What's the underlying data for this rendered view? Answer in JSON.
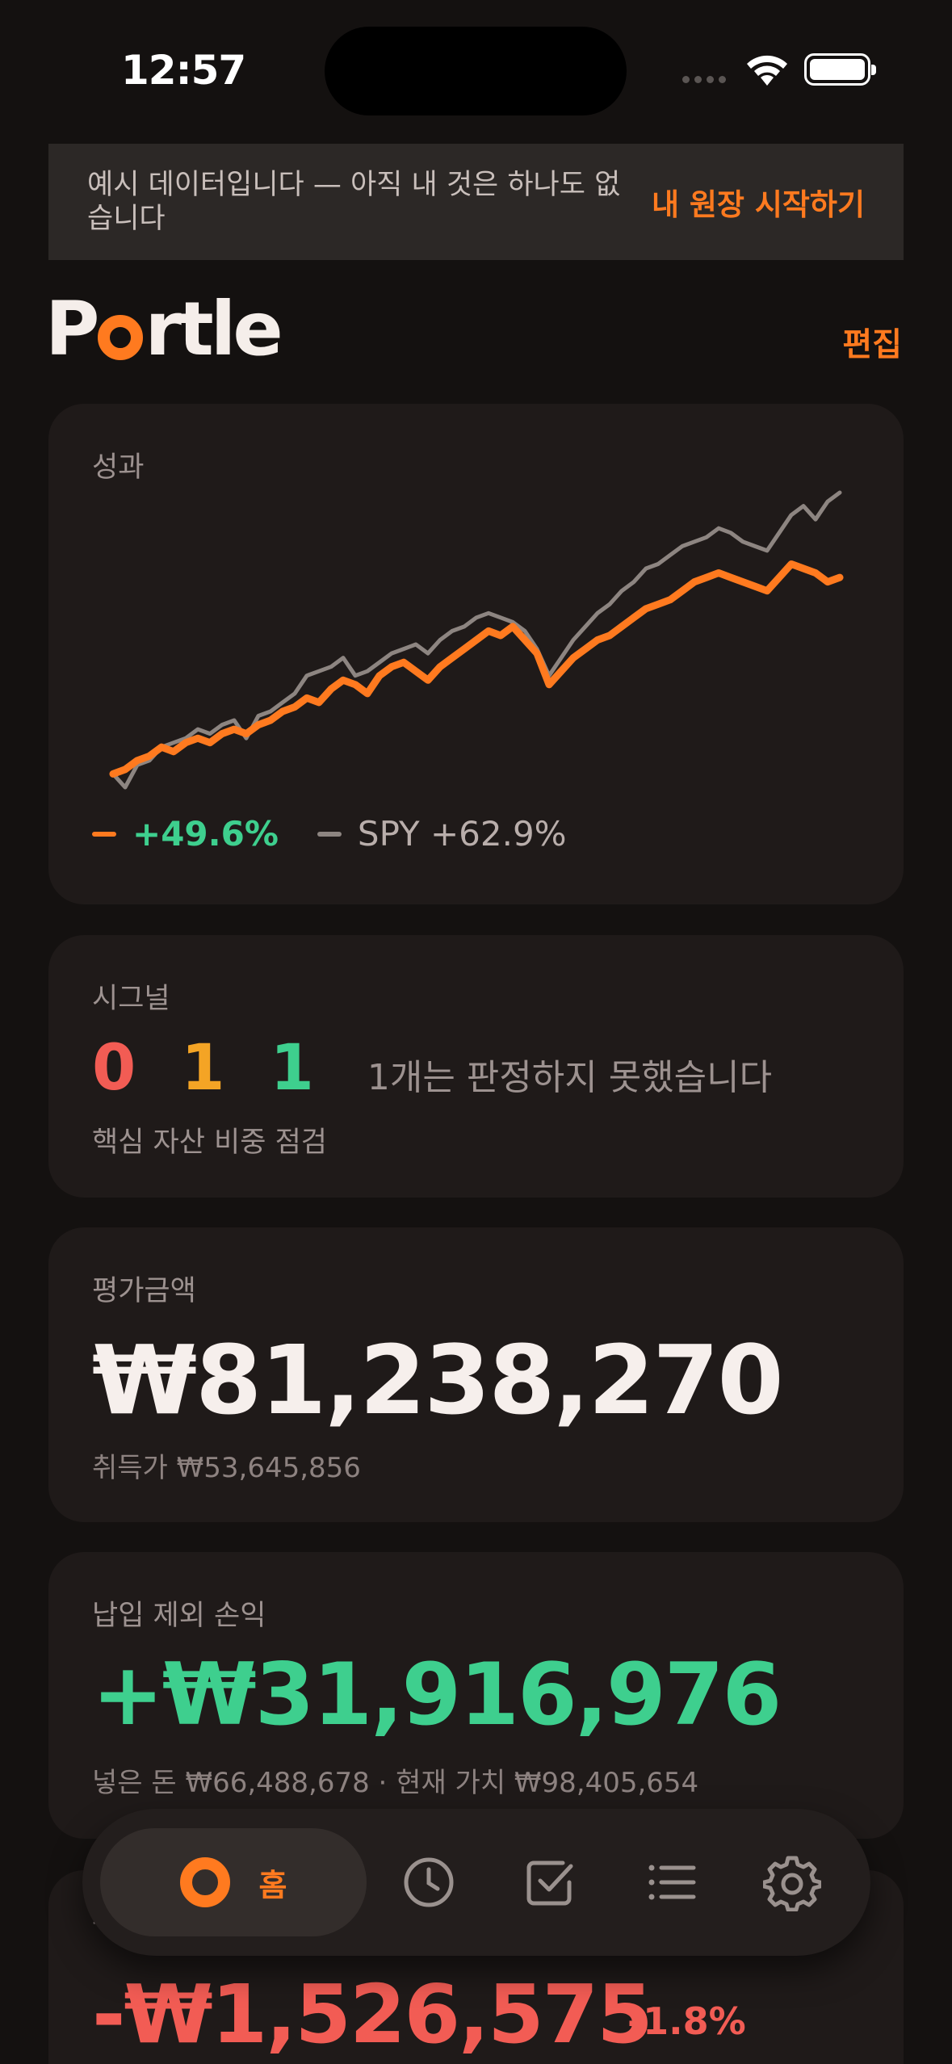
{
  "status": {
    "time": "12:57"
  },
  "banner": {
    "text": "예시 데이터입니다 — 아직 내 것은 하나도 없습니다",
    "cta": "내 원장 시작하기"
  },
  "header": {
    "logo_before": "P",
    "logo_after": "rtle",
    "edit": "편집"
  },
  "performance": {
    "label": "성과",
    "portfolio_return": "+49.6%",
    "benchmark_label": "SPY +62.9%",
    "colors": {
      "portfolio": "#ff7a1f",
      "benchmark": "#8d8581"
    }
  },
  "chart_data": {
    "type": "line",
    "title": "",
    "xlabel": "",
    "ylabel": "",
    "x": [
      0,
      1,
      2,
      3,
      4,
      5,
      6,
      7,
      8,
      9,
      10,
      11,
      12,
      13,
      14,
      15,
      16,
      17,
      18,
      19,
      20,
      21,
      22,
      23,
      24,
      25,
      26,
      27,
      28,
      29,
      30,
      31,
      32,
      33,
      34,
      35,
      36,
      37,
      38,
      39,
      40,
      41,
      42,
      43,
      44,
      45,
      46,
      47,
      48,
      49,
      50,
      51,
      52,
      53,
      54,
      55,
      56,
      57,
      58,
      59,
      60
    ],
    "series": [
      {
        "name": "+49.6%",
        "values": [
          0,
          1,
          3,
          4,
          6,
          5,
          7,
          8,
          7,
          9,
          10,
          9,
          11,
          12,
          14,
          15,
          17,
          16,
          19,
          21,
          20,
          18,
          22,
          24,
          25,
          23,
          21,
          24,
          26,
          28,
          30,
          32,
          31,
          33,
          30,
          27,
          20,
          23,
          26,
          28,
          30,
          31,
          33,
          35,
          37,
          38,
          39,
          41,
          43,
          44,
          45,
          44,
          43,
          42,
          41,
          44,
          47,
          46,
          45,
          43,
          44
        ]
      },
      {
        "name": "SPY +62.9%",
        "values": [
          0,
          -3,
          2,
          3,
          6,
          7,
          8,
          10,
          9,
          11,
          12,
          8,
          13,
          14,
          16,
          18,
          22,
          23,
          24,
          26,
          22,
          23,
          25,
          27,
          28,
          29,
          27,
          30,
          32,
          33,
          35,
          36,
          35,
          34,
          32,
          28,
          22,
          26,
          30,
          33,
          36,
          38,
          41,
          43,
          46,
          47,
          49,
          51,
          52,
          53,
          55,
          54,
          52,
          51,
          50,
          54,
          58,
          60,
          57,
          61,
          63
        ]
      }
    ]
  },
  "signals": {
    "label": "시그널",
    "red": "0",
    "yellow": "1",
    "green": "1",
    "note": "1개는 판정하지 못했습니다",
    "sub": "핵심 자산 비중 점검",
    "colors": {
      "red": "#f25c54",
      "yellow": "#f4a425",
      "green": "#3ecf8e"
    }
  },
  "valuation": {
    "label": "평가금액",
    "amount": "₩81,238,270",
    "cost": "취득가 ₩53,645,856"
  },
  "pnl": {
    "label": "납입 제외 손익",
    "amount": "+₩31,916,976",
    "detail": "넣은 돈 ₩66,488,678 · 현재 가치 ₩98,405,654"
  },
  "daily": {
    "label": "–",
    "amount": "-₩1,526,575",
    "pct": "-1.8%"
  },
  "tabbar": {
    "home_label": "홈",
    "icons": [
      "home-ring-icon",
      "clock-icon",
      "checkbox-icon",
      "list-icon",
      "gear-icon"
    ]
  }
}
